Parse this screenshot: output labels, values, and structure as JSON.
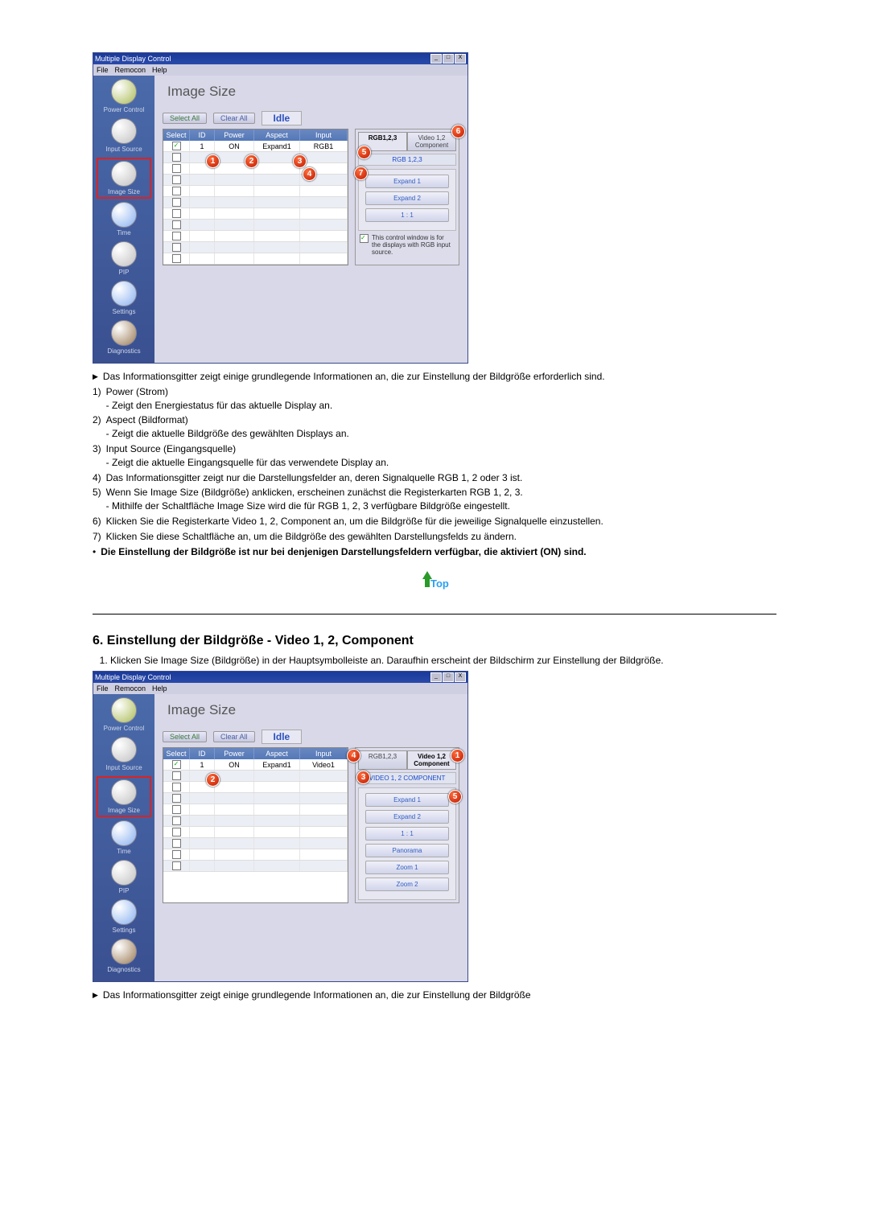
{
  "app": {
    "title": "Multiple Display Control",
    "menu": {
      "file": "File",
      "remocon": "Remocon",
      "help": "Help"
    },
    "window_buttons": {
      "min": "_",
      "max": "□",
      "close": "X"
    }
  },
  "sidebar": {
    "items": [
      {
        "label": "Power Control"
      },
      {
        "label": "Input Source"
      },
      {
        "label": "Image Size"
      },
      {
        "label": "Time"
      },
      {
        "label": "PIP"
      },
      {
        "label": "Settings"
      },
      {
        "label": "Diagnostics"
      }
    ]
  },
  "panel": {
    "title": "Image Size",
    "select_all": "Select All",
    "clear_all": "Clear All",
    "status": "Idle"
  },
  "grid": {
    "headers": {
      "select": "Select",
      "id": "ID",
      "power": "Power",
      "aspect": "Aspect",
      "input": "Input"
    },
    "rows_a": [
      {
        "checked": true,
        "id": "1",
        "power": "ON",
        "aspect": "Expand1",
        "input": "RGB1"
      },
      {
        "checked": false,
        "id": "",
        "power": "",
        "aspect": "",
        "input": ""
      },
      {
        "checked": false,
        "id": "",
        "power": "",
        "aspect": "",
        "input": ""
      },
      {
        "checked": false,
        "id": "",
        "power": "",
        "aspect": "",
        "input": ""
      },
      {
        "checked": false,
        "id": "",
        "power": "",
        "aspect": "",
        "input": ""
      },
      {
        "checked": false,
        "id": "",
        "power": "",
        "aspect": "",
        "input": ""
      },
      {
        "checked": false,
        "id": "",
        "power": "",
        "aspect": "",
        "input": ""
      },
      {
        "checked": false,
        "id": "",
        "power": "",
        "aspect": "",
        "input": ""
      },
      {
        "checked": false,
        "id": "",
        "power": "",
        "aspect": "",
        "input": ""
      },
      {
        "checked": false,
        "id": "",
        "power": "",
        "aspect": "",
        "input": ""
      },
      {
        "checked": false,
        "id": "",
        "power": "",
        "aspect": "",
        "input": ""
      }
    ],
    "rows_b": [
      {
        "checked": true,
        "id": "1",
        "power": "ON",
        "aspect": "Expand1",
        "input": "Video1"
      },
      {
        "checked": false,
        "id": "",
        "power": "",
        "aspect": "",
        "input": ""
      },
      {
        "checked": false,
        "id": "",
        "power": "",
        "aspect": "",
        "input": ""
      },
      {
        "checked": false,
        "id": "",
        "power": "",
        "aspect": "",
        "input": ""
      },
      {
        "checked": false,
        "id": "",
        "power": "",
        "aspect": "",
        "input": ""
      },
      {
        "checked": false,
        "id": "",
        "power": "",
        "aspect": "",
        "input": ""
      },
      {
        "checked": false,
        "id": "",
        "power": "",
        "aspect": "",
        "input": ""
      },
      {
        "checked": false,
        "id": "",
        "power": "",
        "aspect": "",
        "input": ""
      },
      {
        "checked": false,
        "id": "",
        "power": "",
        "aspect": "",
        "input": ""
      },
      {
        "checked": false,
        "id": "",
        "power": "",
        "aspect": "",
        "input": ""
      }
    ]
  },
  "tabs_a": {
    "rgb": "RGB1,2,3",
    "video": "Video 1,2 Component",
    "sub": "RGB 1,2,3",
    "btn1": "Expand 1",
    "btn2": "Expand 2",
    "btn3": "1 : 1",
    "info": "This control window is for the displays with RGB input source."
  },
  "tabs_b": {
    "rgb": "RGB1,2,3",
    "video": "Video 1,2 Component",
    "sub": "VIDEO 1, 2 COMPONENT",
    "btn1": "Expand 1",
    "btn2": "Expand 2",
    "btn3": "1 : 1",
    "btn4": "Panorama",
    "btn5": "Zoom 1",
    "btn6": "Zoom 2"
  },
  "markers": {
    "m1": "1",
    "m2": "2",
    "m3": "3",
    "m4": "4",
    "m5": "5",
    "m6": "6",
    "m7": "7"
  },
  "text_a": {
    "intro": "Das Informationsgitter zeigt einige grundlegende Informationen an, die zur Einstellung der Bildgröße erforderlich sind.",
    "n1_t": "Power (Strom)",
    "n1_b": "- Zeigt den Energiestatus für das aktuelle Display an.",
    "n2_t": "Aspect (Bildformat)",
    "n2_b": "- Zeigt die aktuelle Bildgröße des gewählten Displays an.",
    "n3_t": "Input Source (Eingangsquelle)",
    "n3_b": "- Zeigt die aktuelle Eingangsquelle für das verwendete Display an.",
    "n4": "Das Informationsgitter zeigt nur die Darstellungsfelder an, deren Signalquelle RGB 1, 2 oder 3 ist.",
    "n5a": "Wenn Sie Image Size (Bildgröße) anklicken, erscheinen zunächst die Registerkarten RGB 1, 2, 3.",
    "n5b": "- Mithilfe der Schaltfläche Image Size wird die für RGB 1, 2, 3 verfügbare Bildgröße eingestellt.",
    "n6": "Klicken Sie die Registerkarte Video 1, 2, Component an, um die Bildgröße für die jeweilige Signalquelle einzustellen.",
    "n7": "Klicken Sie diese Schaltfläche an, um die Bildgröße des gewählten Darstellungsfelds zu ändern.",
    "note": "Die Einstellung der Bildgröße ist nur bei denjenigen Darstellungsfeldern verfügbar, die aktiviert (ON) sind."
  },
  "section2": {
    "title": "6. Einstellung der Bildgröße - Video 1, 2, Component",
    "step1": "Klicken Sie Image Size (Bildgröße) in der Hauptsymbolleiste an. Daraufhin erscheint der Bildschirm zur Einstellung der Bildgröße.",
    "intro2": "Das Informationsgitter zeigt einige grundlegende Informationen an, die zur Einstellung der Bildgröße"
  },
  "top_label": "Top"
}
